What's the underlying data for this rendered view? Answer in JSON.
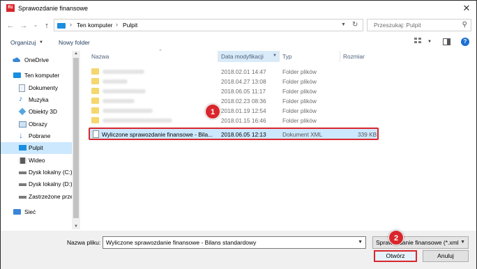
{
  "window": {
    "title": "Sprawozdanie finansowe",
    "app_icon_text": "Rz",
    "close_glyph": "✕"
  },
  "nav": {
    "back_glyph": "←",
    "forward_glyph": "→",
    "recent_glyph": "⌄",
    "up_glyph": "↑",
    "breadcrumb": [
      "Ten komputer",
      "Pulpit"
    ],
    "sep_glyph": "›",
    "search_placeholder": "Przeszukaj: Pulpit"
  },
  "toolbar": {
    "organize_label": "Organizuj",
    "new_folder_label": "Nowy folder",
    "help_glyph": "?"
  },
  "sidebar": {
    "items": [
      {
        "label": "OneDrive",
        "icon": "cloud-icon",
        "color": "#3b86d6",
        "selected": false
      },
      {
        "label": "Ten komputer",
        "icon": "computer-icon",
        "color": "#1a8ee0",
        "selected": false
      },
      {
        "label": "Dokumenty",
        "icon": "documents-icon",
        "color": "#9eb7d0",
        "selected": false
      },
      {
        "label": "Muzyka",
        "icon": "music-icon",
        "color": "#2f7fd8",
        "selected": false
      },
      {
        "label": "Obiekty 3D",
        "icon": "3d-objects-icon",
        "color": "#54a6e0",
        "selected": false
      },
      {
        "label": "Obrazy",
        "icon": "pictures-icon",
        "color": "#8fb8d8",
        "selected": false
      },
      {
        "label": "Pobrane",
        "icon": "downloads-icon",
        "color": "#2f7fd8",
        "selected": false
      },
      {
        "label": "Pulpit",
        "icon": "desktop-icon",
        "color": "#1a8ee0",
        "selected": true
      },
      {
        "label": "Wideo",
        "icon": "video-icon",
        "color": "#5a5a5a",
        "selected": false
      },
      {
        "label": "Dysk lokalny (C:)",
        "icon": "drive-icon",
        "color": "#7a7a7a",
        "selected": false
      },
      {
        "label": "Dysk lokalny (D:)",
        "icon": "drive-icon",
        "color": "#7a7a7a",
        "selected": false
      },
      {
        "label": "Zastrzeżone prze",
        "icon": "drive-icon",
        "color": "#7a7a7a",
        "selected": false
      },
      {
        "label": "Sieć",
        "icon": "network-icon",
        "color": "#3b86d6",
        "selected": false
      }
    ]
  },
  "columns": {
    "name": "Nazwa",
    "date": "Data modyfikacji",
    "type": "Typ",
    "size": "Rozmiar"
  },
  "files": [
    {
      "date": "2018.02.01 14:47",
      "type": "Folder plików",
      "size": ""
    },
    {
      "date": "2018.04.27 13:08",
      "type": "Folder plików",
      "size": ""
    },
    {
      "date": "2018.06.05 11:17",
      "type": "Folder plików",
      "size": ""
    },
    {
      "date": "2018.02.23 08:36",
      "type": "Folder plików",
      "size": ""
    },
    {
      "date": "2018.01.19 12:54",
      "type": "Folder plików",
      "size": ""
    },
    {
      "date": "2018.01.15 16:46",
      "type": "Folder plików",
      "size": ""
    },
    {
      "name": "Wyliczone sprawozdanie finansowe - Bila...",
      "date": "2018.06.05 12:13",
      "type": "Dokument XML",
      "size": "339 KB"
    }
  ],
  "badges": {
    "first": "1",
    "second": "2"
  },
  "footer": {
    "filename_label": "Nazwa pliku:",
    "filename_value": "Wyliczone sprawozdanie finansowe - Bilans standardowy",
    "filetype_value": "Sprawozdanie finansowe (*.xml",
    "open_label": "Otwórz",
    "cancel_label": "Anuluj"
  },
  "colors": {
    "accent_red": "#d9262c",
    "selection_blue": "#cce8ff"
  }
}
